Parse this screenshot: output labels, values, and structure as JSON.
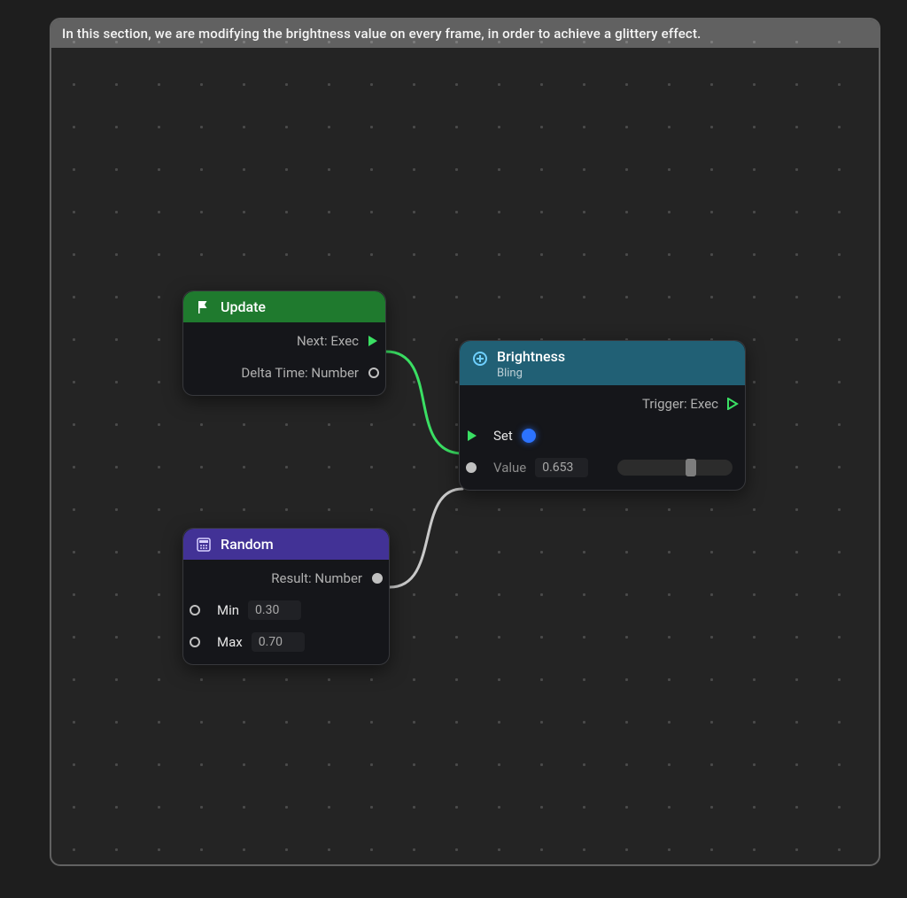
{
  "banner": "In this section, we are modifying the brightness value on every frame, in order to achieve a glittery effect.",
  "nodes": {
    "update": {
      "title": "Update",
      "next_label": "Next: Exec",
      "delta_label": "Delta Time: Number"
    },
    "brightness": {
      "title": "Brightness",
      "subtitle": "Bling",
      "trigger_label": "Trigger: Exec",
      "set_label": "Set",
      "value_label": "Value",
      "value": "0.653",
      "slider_pct": 0.65
    },
    "random": {
      "title": "Random",
      "result_label": "Result: Number",
      "min_label": "Min",
      "min_value": "0.30",
      "max_label": "Max",
      "max_value": "0.70"
    }
  }
}
